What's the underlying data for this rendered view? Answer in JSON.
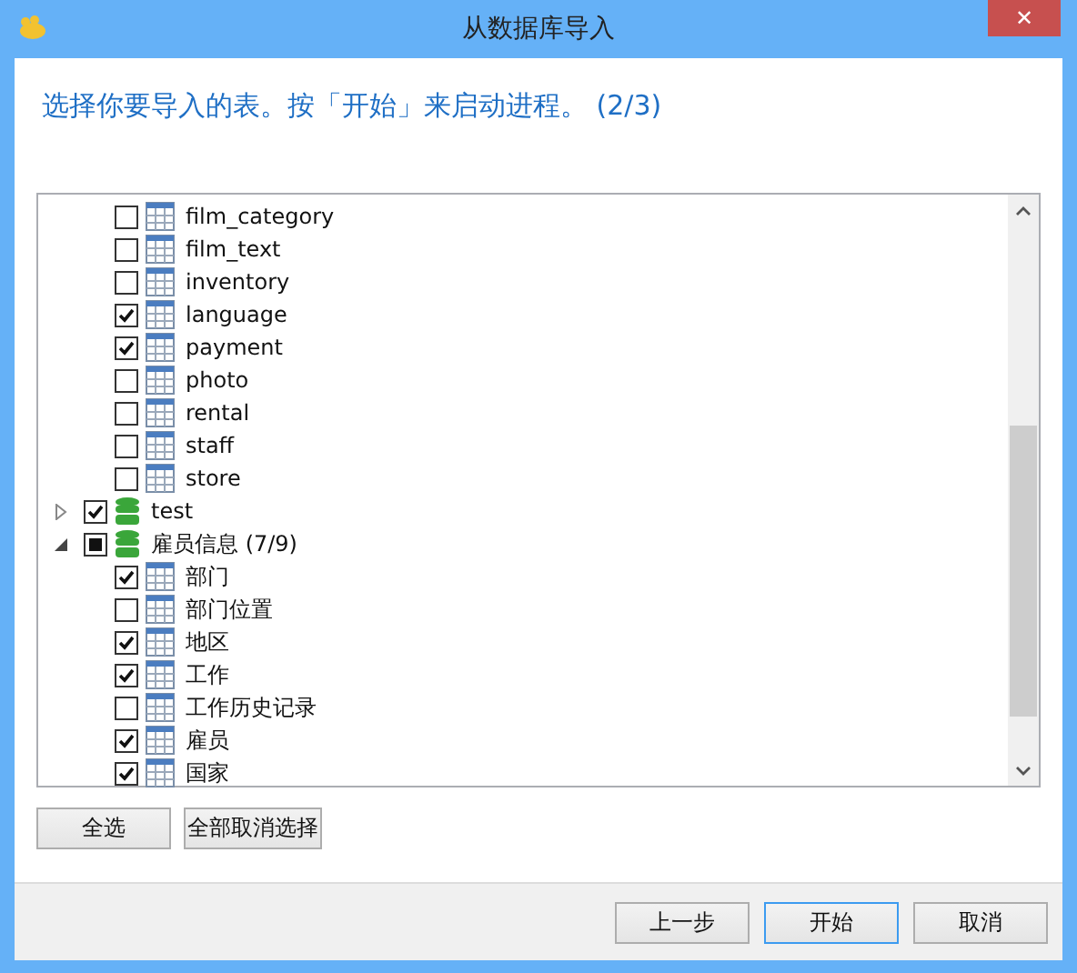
{
  "window": {
    "title": "从数据库导入",
    "close": "✕"
  },
  "instruction": "选择你要导入的表。按「开始」来启动进程。 (2/3)",
  "tree": {
    "continued_children": [
      {
        "kind": "table",
        "name": "film_category",
        "checked": false
      },
      {
        "kind": "table",
        "name": "film_text",
        "checked": false
      },
      {
        "kind": "table",
        "name": "inventory",
        "checked": false
      },
      {
        "kind": "table",
        "name": "language",
        "checked": true
      },
      {
        "kind": "table",
        "name": "payment",
        "checked": true
      },
      {
        "kind": "table",
        "name": "photo",
        "checked": false
      },
      {
        "kind": "table",
        "name": "rental",
        "checked": false
      },
      {
        "kind": "table",
        "name": "staff",
        "checked": false
      },
      {
        "kind": "table",
        "name": "store",
        "checked": false
      }
    ],
    "items": [
      {
        "kind": "database",
        "name": "test",
        "checked": true,
        "expanded": false
      },
      {
        "kind": "database",
        "name": "雇员信息 (7/9)",
        "partial": true,
        "expanded": true,
        "children": [
          {
            "kind": "table",
            "name": "部门",
            "checked": true
          },
          {
            "kind": "table",
            "name": "部门位置",
            "checked": false
          },
          {
            "kind": "table",
            "name": "地区",
            "checked": true
          },
          {
            "kind": "table",
            "name": "工作",
            "checked": true
          },
          {
            "kind": "table",
            "name": "工作历史记录",
            "checked": false
          },
          {
            "kind": "table",
            "name": "雇员",
            "checked": true
          },
          {
            "kind": "table",
            "name": "国家",
            "checked": true
          }
        ]
      }
    ]
  },
  "selection_buttons": [
    "全选",
    "全部取消选择"
  ],
  "footer_buttons": [
    {
      "label": "上一步",
      "default": false
    },
    {
      "label": "开始",
      "default": true
    },
    {
      "label": "取消",
      "default": false
    }
  ]
}
